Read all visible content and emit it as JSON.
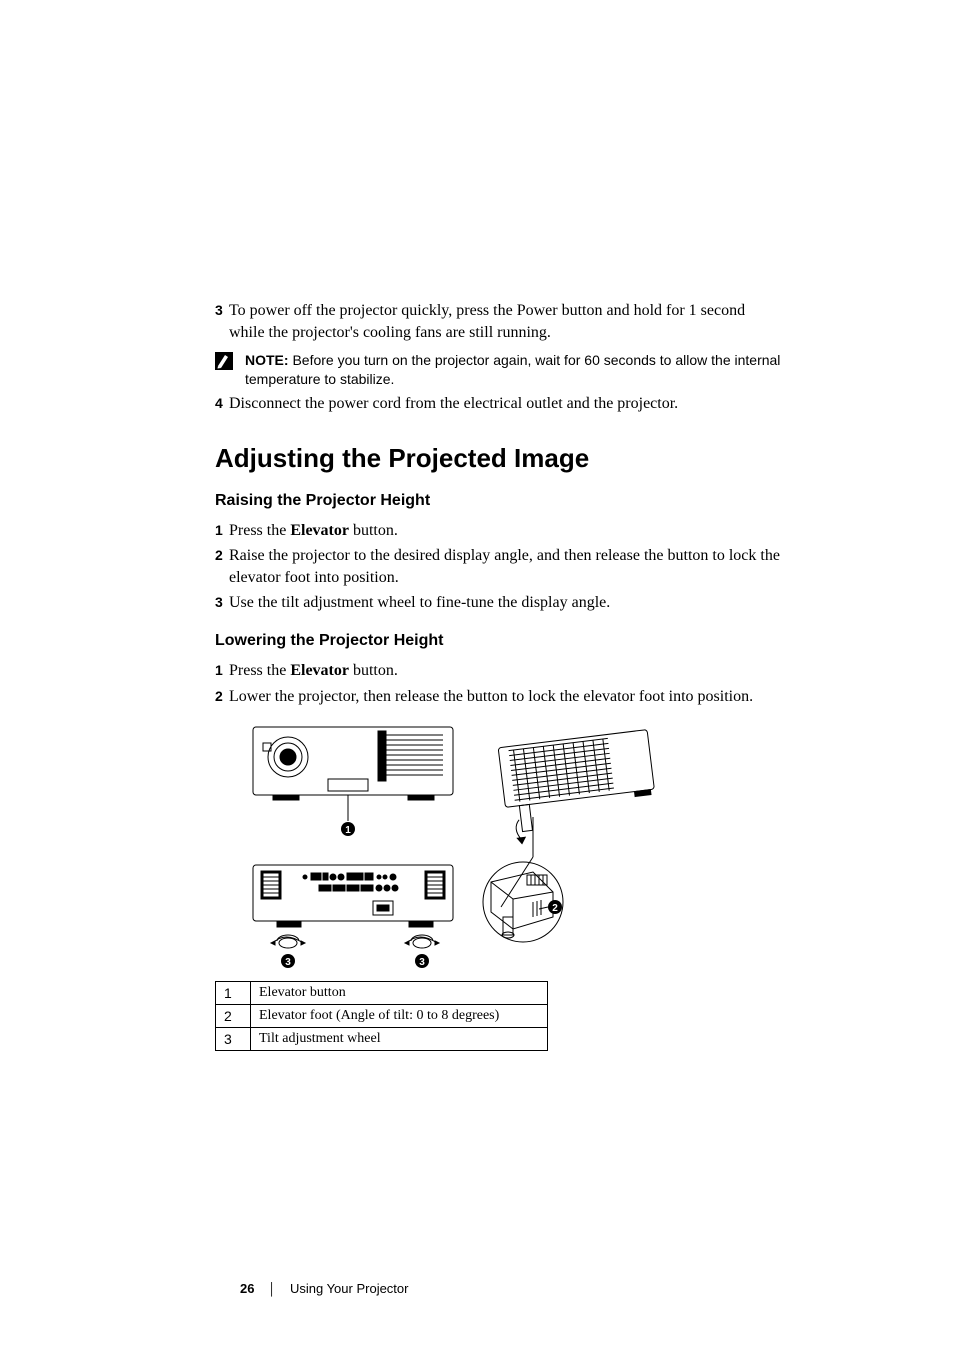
{
  "steps_top": [
    {
      "num": "3",
      "text": "To power off the projector quickly, press the Power button and hold for 1 second while the projector's cooling fans are still running."
    }
  ],
  "note": {
    "label": "NOTE:",
    "text": " Before you turn on the projector again, wait for 60 seconds to allow the internal temperature to stabilize."
  },
  "steps_after_note": [
    {
      "num": "4",
      "text": "Disconnect the power cord from the electrical outlet and the projector."
    }
  ],
  "heading1": "Adjusting the Projected Image",
  "section_raise": {
    "title": "Raising the Projector Height",
    "steps": [
      {
        "num": "1",
        "prefix": "Press the ",
        "bold": "Elevator",
        "suffix": " button."
      },
      {
        "num": "2",
        "text": "Raise the projector to the desired display angle, and then release the button to lock the elevator foot into position."
      },
      {
        "num": "3",
        "text": "Use the tilt adjustment wheel to fine-tune the display angle."
      }
    ]
  },
  "section_lower": {
    "title": "Lowering the Projector Height",
    "steps": [
      {
        "num": "1",
        "prefix": "Press the ",
        "bold": "Elevator",
        "suffix": " button."
      },
      {
        "num": "2",
        "text": "Lower the projector, then release the button to lock the elevator foot into position."
      }
    ]
  },
  "callouts": {
    "c1": "1",
    "c2": "2",
    "c3": "3"
  },
  "parts": [
    {
      "idx": "1",
      "desc": "Elevator button"
    },
    {
      "idx": "2",
      "desc": "Elevator foot (Angle of tilt: 0 to 8 degrees)"
    },
    {
      "idx": "3",
      "desc": "Tilt adjustment wheel"
    }
  ],
  "footer": {
    "page": "26",
    "chapter": "Using Your Projector"
  }
}
